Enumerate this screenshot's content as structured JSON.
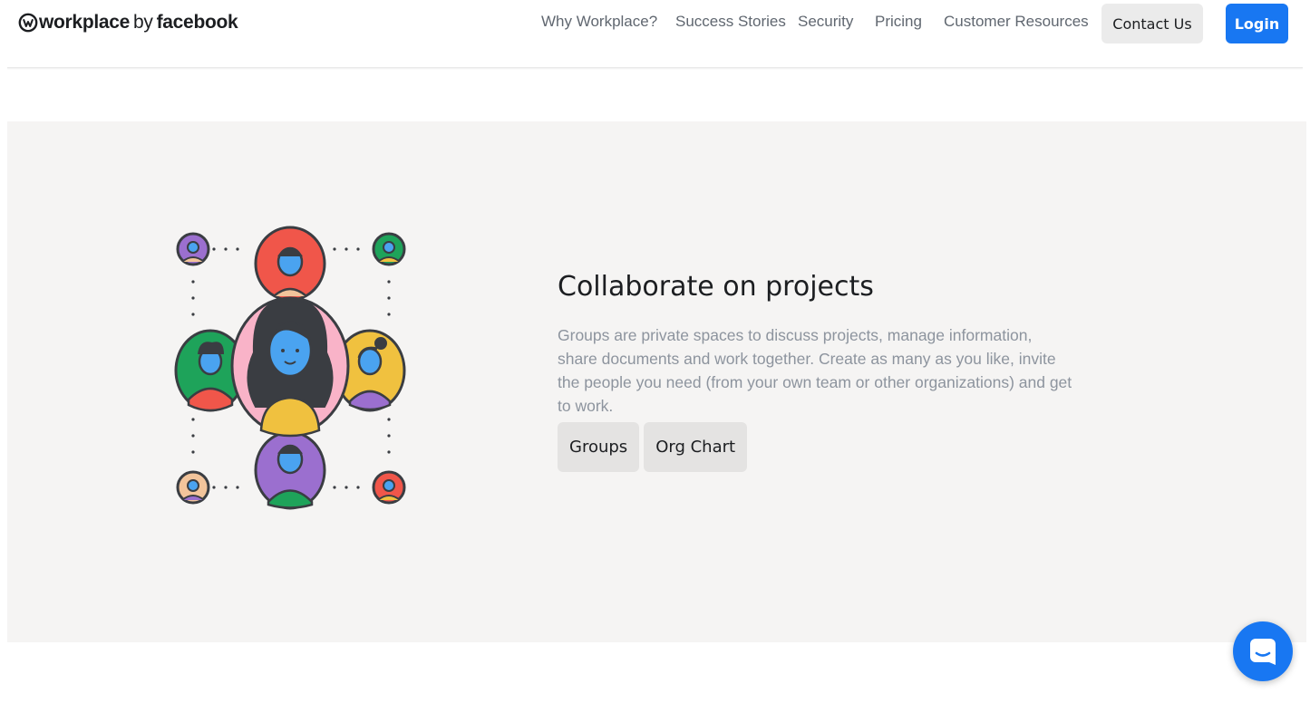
{
  "header": {
    "logo": {
      "part1": "workplace",
      "by": "by",
      "part2": "facebook"
    },
    "nav": [
      {
        "label": "Why Workplace?"
      },
      {
        "label": "Success Stories"
      },
      {
        "label": "Security"
      },
      {
        "label": "Pricing"
      },
      {
        "label": "Customer Resources"
      }
    ],
    "contact_label": "Contact Us",
    "login_label": "Login"
  },
  "feature": {
    "title": "Collaborate on projects",
    "body": "Groups are private spaces to discuss projects, manage information, share documents and work together. Create as many as you like, invite the people you need (from your own team or other organizations) and get to work.",
    "buttons": [
      {
        "label": "Groups"
      },
      {
        "label": "Org Chart"
      }
    ]
  },
  "chat": {
    "icon": "chat-bubble-icon"
  },
  "colors": {
    "brand": "#1877f2",
    "section_bg": "#f5f4f3",
    "chip_bg": "#e4e3e2",
    "body_text": "#8d949e"
  }
}
